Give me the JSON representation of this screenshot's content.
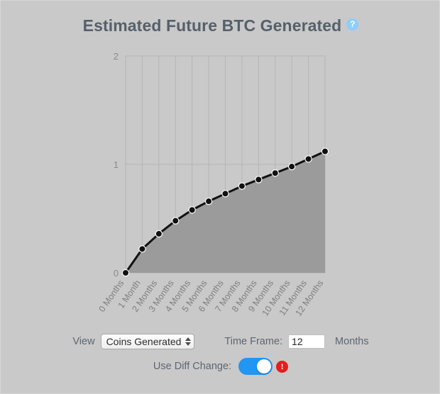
{
  "header": {
    "title": "Estimated Future BTC Generated",
    "help_icon": "question-mark-icon",
    "help_glyph": "?",
    "help_color": "#8ecdfc",
    "title_color": "#56606b"
  },
  "controls": {
    "view_label": "View",
    "view_selected": "Coins Generated",
    "view_options": [
      "Coins Generated"
    ],
    "time_frame_label": "Time Frame:",
    "time_frame_value": "12",
    "time_frame_placeholder": "12",
    "time_frame_unit": "Months",
    "diff_change_label": "Use Diff Change:",
    "diff_change_on": true,
    "toggle_color": "#2196f3",
    "alert_glyph": "!",
    "alert_color": "#e41d1d"
  },
  "chart_data": {
    "type": "area",
    "title": "Estimated Future BTC Generated",
    "xlabel": "",
    "ylabel": "",
    "categories": [
      "0 Months",
      "1 Month",
      "2 Months",
      "3 Months",
      "4 Months",
      "5 Months",
      "6 Months",
      "7 Months",
      "8 Months",
      "9 Months",
      "10 Months",
      "11 Months",
      "12 Months"
    ],
    "x": [
      0,
      1,
      2,
      3,
      4,
      5,
      6,
      7,
      8,
      9,
      10,
      11,
      12
    ],
    "values": [
      0,
      0.22,
      0.36,
      0.48,
      0.58,
      0.66,
      0.73,
      0.8,
      0.86,
      0.92,
      0.98,
      1.05,
      1.12
    ],
    "ylim": [
      0,
      2
    ],
    "yticks": [
      0,
      1,
      2
    ],
    "ytick_labels": [
      "0",
      "1",
      "2"
    ],
    "grid": true,
    "grid_axis": "x",
    "legend": "none",
    "line_color": "#111111",
    "marker_color": "#111111",
    "fill_color": "#9b9b9b",
    "grid_color": "#b5b5b5",
    "tick_color": "#8a8a8a",
    "background": "#c9c9c9"
  }
}
